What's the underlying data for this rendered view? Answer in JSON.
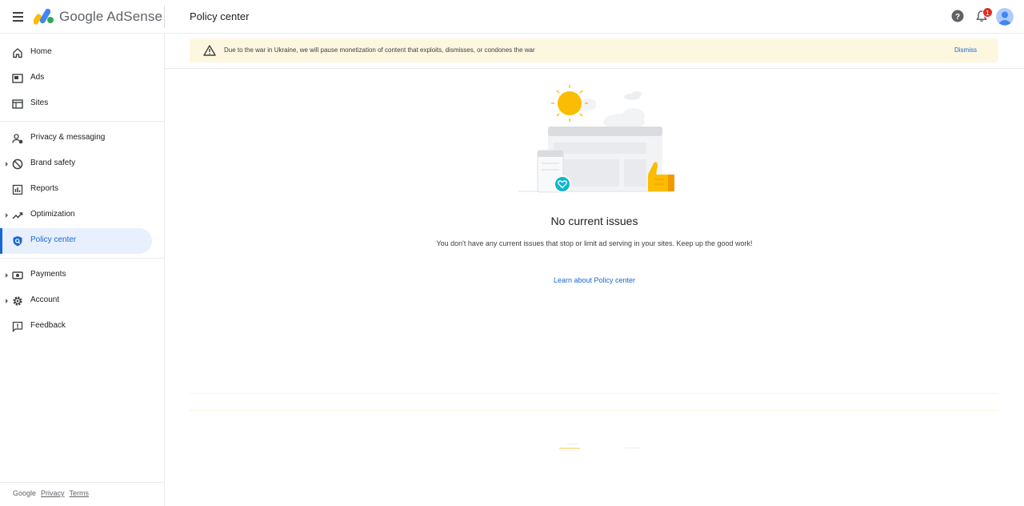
{
  "header": {
    "brand": "Google AdSense",
    "page_title": "Policy center",
    "notification_count": "1"
  },
  "sidebar": {
    "items": [
      {
        "label": "Home",
        "icon": "home-icon"
      },
      {
        "label": "Ads",
        "icon": "ads-icon"
      },
      {
        "label": "Sites",
        "icon": "sites-icon"
      },
      {
        "label": "Privacy & messaging",
        "icon": "privacy-icon"
      },
      {
        "label": "Brand safety",
        "icon": "brand-safety-icon",
        "expandable": true
      },
      {
        "label": "Reports",
        "icon": "reports-icon"
      },
      {
        "label": "Optimization",
        "icon": "optimization-icon",
        "expandable": true
      },
      {
        "label": "Policy center",
        "icon": "policy-shield-icon",
        "active": true
      },
      {
        "label": "Payments",
        "icon": "payments-icon",
        "expandable": true
      },
      {
        "label": "Account",
        "icon": "account-gear-icon",
        "expandable": true
      },
      {
        "label": "Feedback",
        "icon": "feedback-icon"
      }
    ],
    "footer": {
      "google": "Google",
      "privacy": "Privacy",
      "terms": "Terms"
    }
  },
  "banner": {
    "text": "Due to the war in Ukraine, we will pause monetization of content that exploits, dismisses, or condones the war",
    "dismiss": "Dismiss"
  },
  "main": {
    "title": "No current issues",
    "description": "You don't have any current issues that stop or limit ad serving in your sites. Keep up the good work!",
    "learn_link": "Learn about Policy center"
  },
  "colors": {
    "accent": "#1967d2",
    "active_bg": "#e8f0fe",
    "banner_bg": "#fef7e0",
    "sun": "#fbbc04",
    "badge": "#d93025"
  }
}
